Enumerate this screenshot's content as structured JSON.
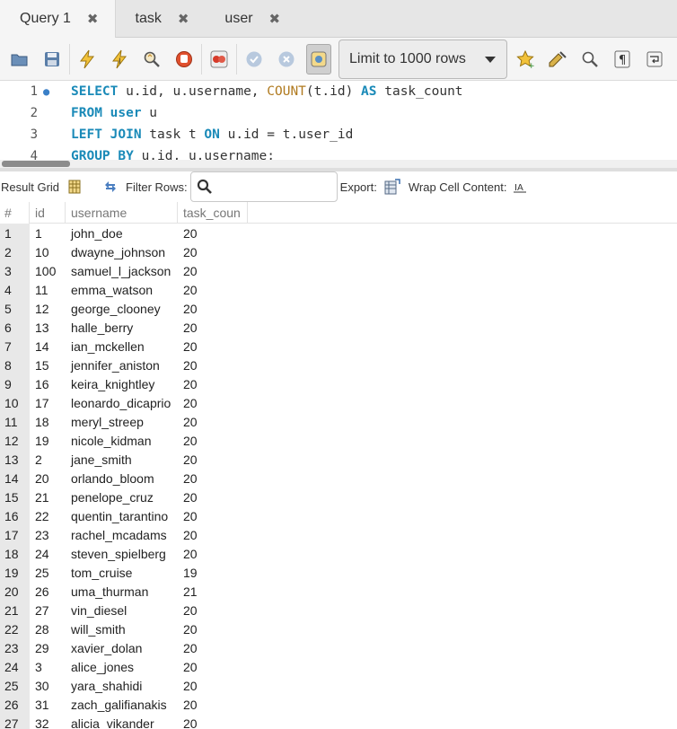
{
  "tabs": [
    {
      "label": "Query 1",
      "active": true
    },
    {
      "label": "task",
      "active": false
    },
    {
      "label": "user",
      "active": false
    }
  ],
  "tab_close_glyph": "✖",
  "toolbar": {
    "limit_label": "Limit to 1000 rows"
  },
  "editor": {
    "lines": [
      {
        "num": "1",
        "marker": "●"
      },
      {
        "num": "2",
        "marker": ""
      },
      {
        "num": "3",
        "marker": ""
      },
      {
        "num": "4",
        "marker": ""
      }
    ],
    "sql": {
      "l1": [
        "SELECT",
        " u.id, u.username, ",
        "COUNT",
        "(t.id) ",
        "AS",
        " task_count"
      ],
      "l2": [
        "FROM",
        " ",
        "user",
        " u"
      ],
      "l3": [
        "LEFT JOIN",
        " task t ",
        "ON",
        " u.id = t.user_id"
      ],
      "l4": [
        "GROUP BY",
        " u.id, u.username;"
      ]
    }
  },
  "result_toolbar": {
    "result_grid_label": "Result Grid",
    "filter_rows_label": "Filter Rows:",
    "filter_value": "",
    "export_label": "Export:",
    "wrap_label": "Wrap Cell Content:"
  },
  "grid": {
    "columns": [
      "#",
      "id",
      "username",
      "task_coun"
    ],
    "rows": [
      [
        "1",
        "1",
        "john_doe",
        "20"
      ],
      [
        "2",
        "10",
        "dwayne_johnson",
        "20"
      ],
      [
        "3",
        "100",
        "samuel_l_jackson",
        "20"
      ],
      [
        "4",
        "11",
        "emma_watson",
        "20"
      ],
      [
        "5",
        "12",
        "george_clooney",
        "20"
      ],
      [
        "6",
        "13",
        "halle_berry",
        "20"
      ],
      [
        "7",
        "14",
        "ian_mckellen",
        "20"
      ],
      [
        "8",
        "15",
        "jennifer_aniston",
        "20"
      ],
      [
        "9",
        "16",
        "keira_knightley",
        "20"
      ],
      [
        "10",
        "17",
        "leonardo_dicaprio",
        "20"
      ],
      [
        "11",
        "18",
        "meryl_streep",
        "20"
      ],
      [
        "12",
        "19",
        "nicole_kidman",
        "20"
      ],
      [
        "13",
        "2",
        "jane_smith",
        "20"
      ],
      [
        "14",
        "20",
        "orlando_bloom",
        "20"
      ],
      [
        "15",
        "21",
        "penelope_cruz",
        "20"
      ],
      [
        "16",
        "22",
        "quentin_tarantino",
        "20"
      ],
      [
        "17",
        "23",
        "rachel_mcadams",
        "20"
      ],
      [
        "18",
        "24",
        "steven_spielberg",
        "20"
      ],
      [
        "19",
        "25",
        "tom_cruise",
        "19"
      ],
      [
        "20",
        "26",
        "uma_thurman",
        "21"
      ],
      [
        "21",
        "27",
        "vin_diesel",
        "20"
      ],
      [
        "22",
        "28",
        "will_smith",
        "20"
      ],
      [
        "23",
        "29",
        "xavier_dolan",
        "20"
      ],
      [
        "24",
        "3",
        "alice_jones",
        "20"
      ],
      [
        "25",
        "30",
        "yara_shahidi",
        "20"
      ],
      [
        "26",
        "31",
        "zach_galifianakis",
        "20"
      ],
      [
        "27",
        "32",
        "alicia_vikander",
        "20"
      ]
    ]
  },
  "icons": [
    "open-folder-icon",
    "save-icon",
    "execute-icon",
    "execute-current-icon",
    "explain-icon",
    "stop-icon",
    "toggle-error-icon",
    "commit-icon",
    "rollback-icon",
    "autocommit-icon",
    "bookmark-star-icon",
    "beautify-icon",
    "find-icon",
    "invisible-chars-icon",
    "wrap-lines-icon",
    "search-icon",
    "refresh-icon",
    "grid-icon",
    "export-icon",
    "wrap-icon"
  ]
}
